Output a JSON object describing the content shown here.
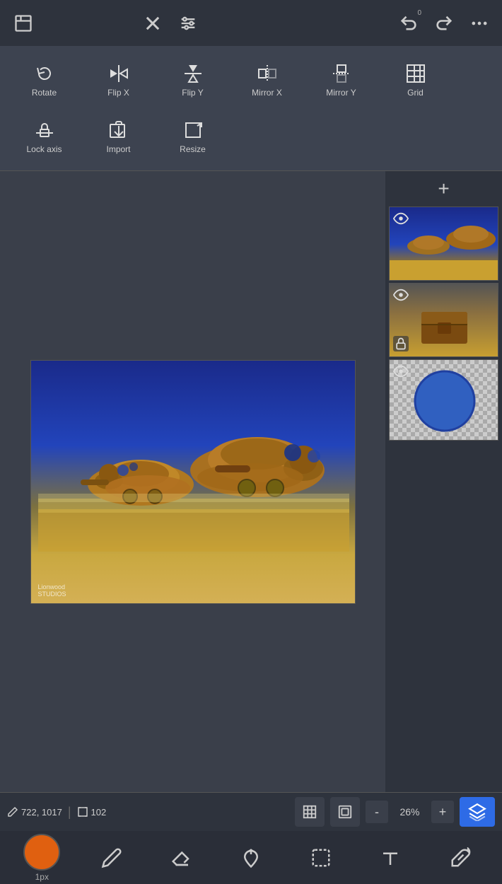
{
  "topToolbar": {
    "file_icon": "folder-icon",
    "close_icon": "close-icon",
    "settings_icon": "settings-icon",
    "undo_icon": "undo-icon",
    "redo_icon": "redo-icon",
    "more_icon": "more-icon",
    "undo_badge": "0"
  },
  "submenu": {
    "items": [
      {
        "id": "rotate",
        "label": "Rotate"
      },
      {
        "id": "flip-x",
        "label": "Flip X"
      },
      {
        "id": "flip-y",
        "label": "Flip Y"
      },
      {
        "id": "mirror-x",
        "label": "Mirror X"
      },
      {
        "id": "mirror-y",
        "label": "Mirror Y"
      },
      {
        "id": "grid",
        "label": "Grid"
      },
      {
        "id": "lock-axis",
        "label": "Lock axis"
      },
      {
        "id": "import",
        "label": "Import"
      },
      {
        "id": "resize",
        "label": "Resize"
      }
    ]
  },
  "canvas": {
    "watermark": "Lionwood\nSTUDIOS"
  },
  "layers": {
    "add_label": "+",
    "items": [
      {
        "id": "layer1",
        "type": "ships",
        "visible": true,
        "locked": false
      },
      {
        "id": "layer2",
        "type": "chest",
        "visible": true,
        "locked": true
      },
      {
        "id": "layer3",
        "type": "circle",
        "visible": true,
        "locked": false
      }
    ]
  },
  "statusBar": {
    "pencil_icon": "pencil-icon",
    "coords": "722, 1017",
    "resize_icon": "resize-icon",
    "dimensions": "102",
    "grid_icon": "grid-icon",
    "frame_icon": "frame-icon",
    "zoom_minus": "-",
    "zoom_value": "26%",
    "zoom_plus": "+",
    "layers_icon": "layers-icon"
  },
  "bottomTools": {
    "color": "#e06010",
    "px_label": "1px",
    "pencil_tool": "pencil-tool",
    "eraser_tool": "eraser-tool",
    "fill_tool": "fill-tool",
    "select_tool": "select-tool",
    "text_tool": "text-tool",
    "eyedropper_tool": "eyedropper-tool"
  }
}
